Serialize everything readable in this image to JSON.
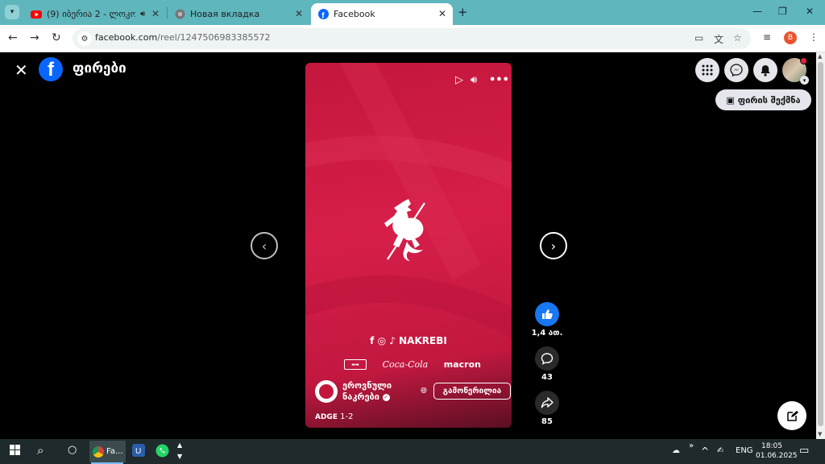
{
  "browser": {
    "tabs": [
      {
        "title": "(9) იბერია 2 - ლოკომოტ",
        "favicon": "youtube-icon",
        "audio": true
      },
      {
        "title": "Новая вкладка",
        "favicon": "chrome-icon",
        "audio": false
      },
      {
        "title": "Facebook",
        "favicon": "facebook-icon",
        "audio": false,
        "active": true
      }
    ],
    "url_host": "facebook.com",
    "url_path": "/reel/1247506983385572",
    "profile_initial": "B"
  },
  "header": {
    "title": "ფირები",
    "logo_letter": "f",
    "create_reel_label": "ფირის შექმნა"
  },
  "reel": {
    "socials_text": "NAKREBI",
    "sponsors": [
      "macron"
    ],
    "sponsor_coca": "Coca-Cola",
    "page_name": "ეროვნული ნაკრები",
    "follow_label": "გამოწერილია",
    "caption_tag": "ADGE",
    "caption_text": "1-2"
  },
  "actions": {
    "likes": "1,4 ათ.",
    "comments": "43",
    "shares": "85"
  },
  "taskbar": {
    "chrome_label": "Fa...",
    "lang": "ENG",
    "time": "18:05",
    "date": "01.06.2025"
  },
  "colors": {
    "accent": "#0866ff",
    "reel_red": "#d61e49",
    "tab_strip": "#5fb6bd"
  }
}
